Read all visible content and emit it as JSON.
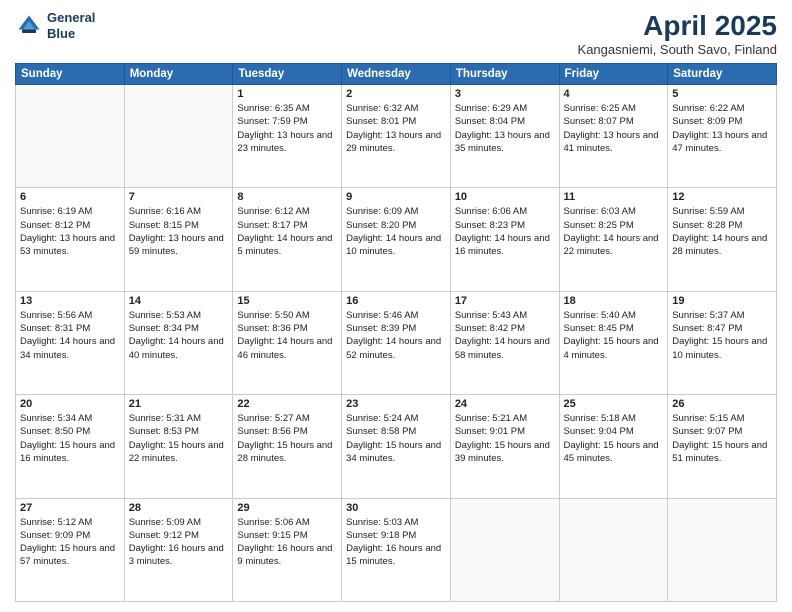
{
  "logo": {
    "line1": "General",
    "line2": "Blue"
  },
  "title": "April 2025",
  "subtitle": "Kangasniemi, South Savo, Finland",
  "days": [
    "Sunday",
    "Monday",
    "Tuesday",
    "Wednesday",
    "Thursday",
    "Friday",
    "Saturday"
  ],
  "weeks": [
    [
      {
        "num": "",
        "sunrise": "",
        "sunset": "",
        "daylight": ""
      },
      {
        "num": "",
        "sunrise": "",
        "sunset": "",
        "daylight": ""
      },
      {
        "num": "1",
        "sunrise": "Sunrise: 6:35 AM",
        "sunset": "Sunset: 7:59 PM",
        "daylight": "Daylight: 13 hours and 23 minutes."
      },
      {
        "num": "2",
        "sunrise": "Sunrise: 6:32 AM",
        "sunset": "Sunset: 8:01 PM",
        "daylight": "Daylight: 13 hours and 29 minutes."
      },
      {
        "num": "3",
        "sunrise": "Sunrise: 6:29 AM",
        "sunset": "Sunset: 8:04 PM",
        "daylight": "Daylight: 13 hours and 35 minutes."
      },
      {
        "num": "4",
        "sunrise": "Sunrise: 6:25 AM",
        "sunset": "Sunset: 8:07 PM",
        "daylight": "Daylight: 13 hours and 41 minutes."
      },
      {
        "num": "5",
        "sunrise": "Sunrise: 6:22 AM",
        "sunset": "Sunset: 8:09 PM",
        "daylight": "Daylight: 13 hours and 47 minutes."
      }
    ],
    [
      {
        "num": "6",
        "sunrise": "Sunrise: 6:19 AM",
        "sunset": "Sunset: 8:12 PM",
        "daylight": "Daylight: 13 hours and 53 minutes."
      },
      {
        "num": "7",
        "sunrise": "Sunrise: 6:16 AM",
        "sunset": "Sunset: 8:15 PM",
        "daylight": "Daylight: 13 hours and 59 minutes."
      },
      {
        "num": "8",
        "sunrise": "Sunrise: 6:12 AM",
        "sunset": "Sunset: 8:17 PM",
        "daylight": "Daylight: 14 hours and 5 minutes."
      },
      {
        "num": "9",
        "sunrise": "Sunrise: 6:09 AM",
        "sunset": "Sunset: 8:20 PM",
        "daylight": "Daylight: 14 hours and 10 minutes."
      },
      {
        "num": "10",
        "sunrise": "Sunrise: 6:06 AM",
        "sunset": "Sunset: 8:23 PM",
        "daylight": "Daylight: 14 hours and 16 minutes."
      },
      {
        "num": "11",
        "sunrise": "Sunrise: 6:03 AM",
        "sunset": "Sunset: 8:25 PM",
        "daylight": "Daylight: 14 hours and 22 minutes."
      },
      {
        "num": "12",
        "sunrise": "Sunrise: 5:59 AM",
        "sunset": "Sunset: 8:28 PM",
        "daylight": "Daylight: 14 hours and 28 minutes."
      }
    ],
    [
      {
        "num": "13",
        "sunrise": "Sunrise: 5:56 AM",
        "sunset": "Sunset: 8:31 PM",
        "daylight": "Daylight: 14 hours and 34 minutes."
      },
      {
        "num": "14",
        "sunrise": "Sunrise: 5:53 AM",
        "sunset": "Sunset: 8:34 PM",
        "daylight": "Daylight: 14 hours and 40 minutes."
      },
      {
        "num": "15",
        "sunrise": "Sunrise: 5:50 AM",
        "sunset": "Sunset: 8:36 PM",
        "daylight": "Daylight: 14 hours and 46 minutes."
      },
      {
        "num": "16",
        "sunrise": "Sunrise: 5:46 AM",
        "sunset": "Sunset: 8:39 PM",
        "daylight": "Daylight: 14 hours and 52 minutes."
      },
      {
        "num": "17",
        "sunrise": "Sunrise: 5:43 AM",
        "sunset": "Sunset: 8:42 PM",
        "daylight": "Daylight: 14 hours and 58 minutes."
      },
      {
        "num": "18",
        "sunrise": "Sunrise: 5:40 AM",
        "sunset": "Sunset: 8:45 PM",
        "daylight": "Daylight: 15 hours and 4 minutes."
      },
      {
        "num": "19",
        "sunrise": "Sunrise: 5:37 AM",
        "sunset": "Sunset: 8:47 PM",
        "daylight": "Daylight: 15 hours and 10 minutes."
      }
    ],
    [
      {
        "num": "20",
        "sunrise": "Sunrise: 5:34 AM",
        "sunset": "Sunset: 8:50 PM",
        "daylight": "Daylight: 15 hours and 16 minutes."
      },
      {
        "num": "21",
        "sunrise": "Sunrise: 5:31 AM",
        "sunset": "Sunset: 8:53 PM",
        "daylight": "Daylight: 15 hours and 22 minutes."
      },
      {
        "num": "22",
        "sunrise": "Sunrise: 5:27 AM",
        "sunset": "Sunset: 8:56 PM",
        "daylight": "Daylight: 15 hours and 28 minutes."
      },
      {
        "num": "23",
        "sunrise": "Sunrise: 5:24 AM",
        "sunset": "Sunset: 8:58 PM",
        "daylight": "Daylight: 15 hours and 34 minutes."
      },
      {
        "num": "24",
        "sunrise": "Sunrise: 5:21 AM",
        "sunset": "Sunset: 9:01 PM",
        "daylight": "Daylight: 15 hours and 39 minutes."
      },
      {
        "num": "25",
        "sunrise": "Sunrise: 5:18 AM",
        "sunset": "Sunset: 9:04 PM",
        "daylight": "Daylight: 15 hours and 45 minutes."
      },
      {
        "num": "26",
        "sunrise": "Sunrise: 5:15 AM",
        "sunset": "Sunset: 9:07 PM",
        "daylight": "Daylight: 15 hours and 51 minutes."
      }
    ],
    [
      {
        "num": "27",
        "sunrise": "Sunrise: 5:12 AM",
        "sunset": "Sunset: 9:09 PM",
        "daylight": "Daylight: 15 hours and 57 minutes."
      },
      {
        "num": "28",
        "sunrise": "Sunrise: 5:09 AM",
        "sunset": "Sunset: 9:12 PM",
        "daylight": "Daylight: 16 hours and 3 minutes."
      },
      {
        "num": "29",
        "sunrise": "Sunrise: 5:06 AM",
        "sunset": "Sunset: 9:15 PM",
        "daylight": "Daylight: 16 hours and 9 minutes."
      },
      {
        "num": "30",
        "sunrise": "Sunrise: 5:03 AM",
        "sunset": "Sunset: 9:18 PM",
        "daylight": "Daylight: 16 hours and 15 minutes."
      },
      {
        "num": "",
        "sunrise": "",
        "sunset": "",
        "daylight": ""
      },
      {
        "num": "",
        "sunrise": "",
        "sunset": "",
        "daylight": ""
      },
      {
        "num": "",
        "sunrise": "",
        "sunset": "",
        "daylight": ""
      }
    ]
  ]
}
